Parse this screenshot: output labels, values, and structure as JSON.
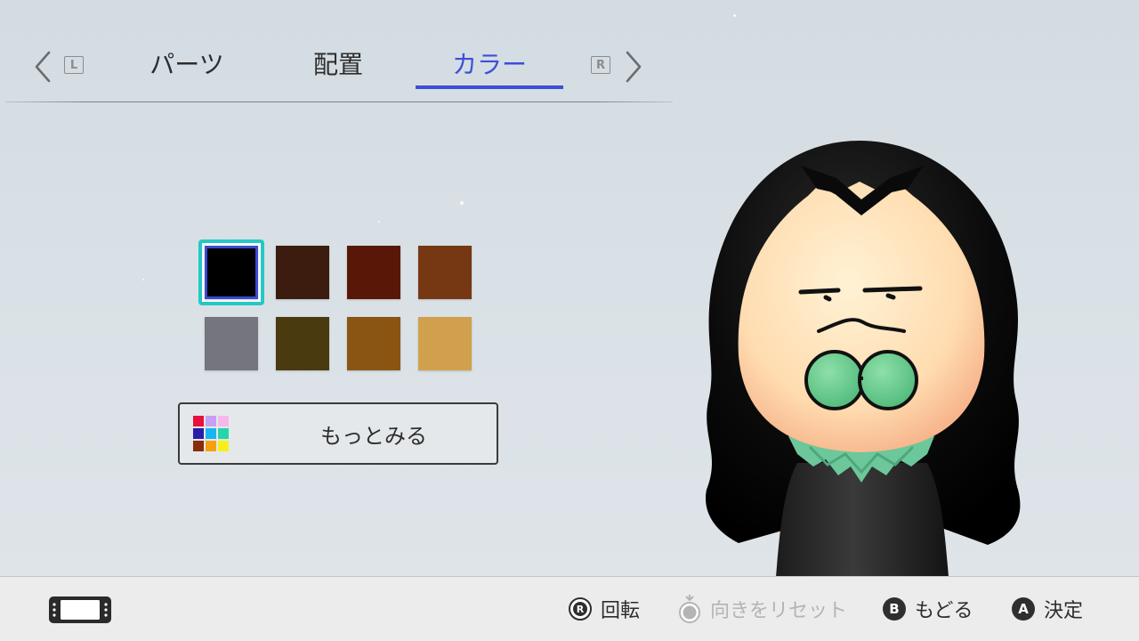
{
  "tabs": {
    "items": [
      {
        "label": "パーツ"
      },
      {
        "label": "配置"
      },
      {
        "label": "カラー"
      }
    ],
    "active_index": 2,
    "left_key": "L",
    "right_key": "R",
    "accent_color": "#3d4fd6"
  },
  "colors": {
    "swatches": [
      "#000000",
      "#3b1c0f",
      "#591708",
      "#763812",
      "#75757d",
      "#4a3a10",
      "#8a5512",
      "#d1a04c"
    ],
    "selected_index": 0,
    "selection_ring_color": "#24c8c5"
  },
  "more_button": {
    "label": "もっとみる",
    "palette": [
      "#e8103c",
      "#c7a0f4",
      "#f6b8ea",
      "#2a1da8",
      "#18b6f0",
      "#26d6a8",
      "#8a2c0a",
      "#f7a00f",
      "#f6f018"
    ]
  },
  "footer": {
    "hints": [
      {
        "button": "R",
        "label": "回転",
        "enabled": true
      },
      {
        "button": "R",
        "label": "向きをリセット",
        "enabled": false
      },
      {
        "button": "B",
        "label": "もどる",
        "enabled": true
      },
      {
        "button": "A",
        "label": "決定",
        "enabled": true
      }
    ]
  },
  "icons": [
    "chevron-left-icon",
    "l-button-icon",
    "r-button-icon",
    "chevron-right-icon",
    "handheld-console-icon",
    "color-palette-icon"
  ]
}
